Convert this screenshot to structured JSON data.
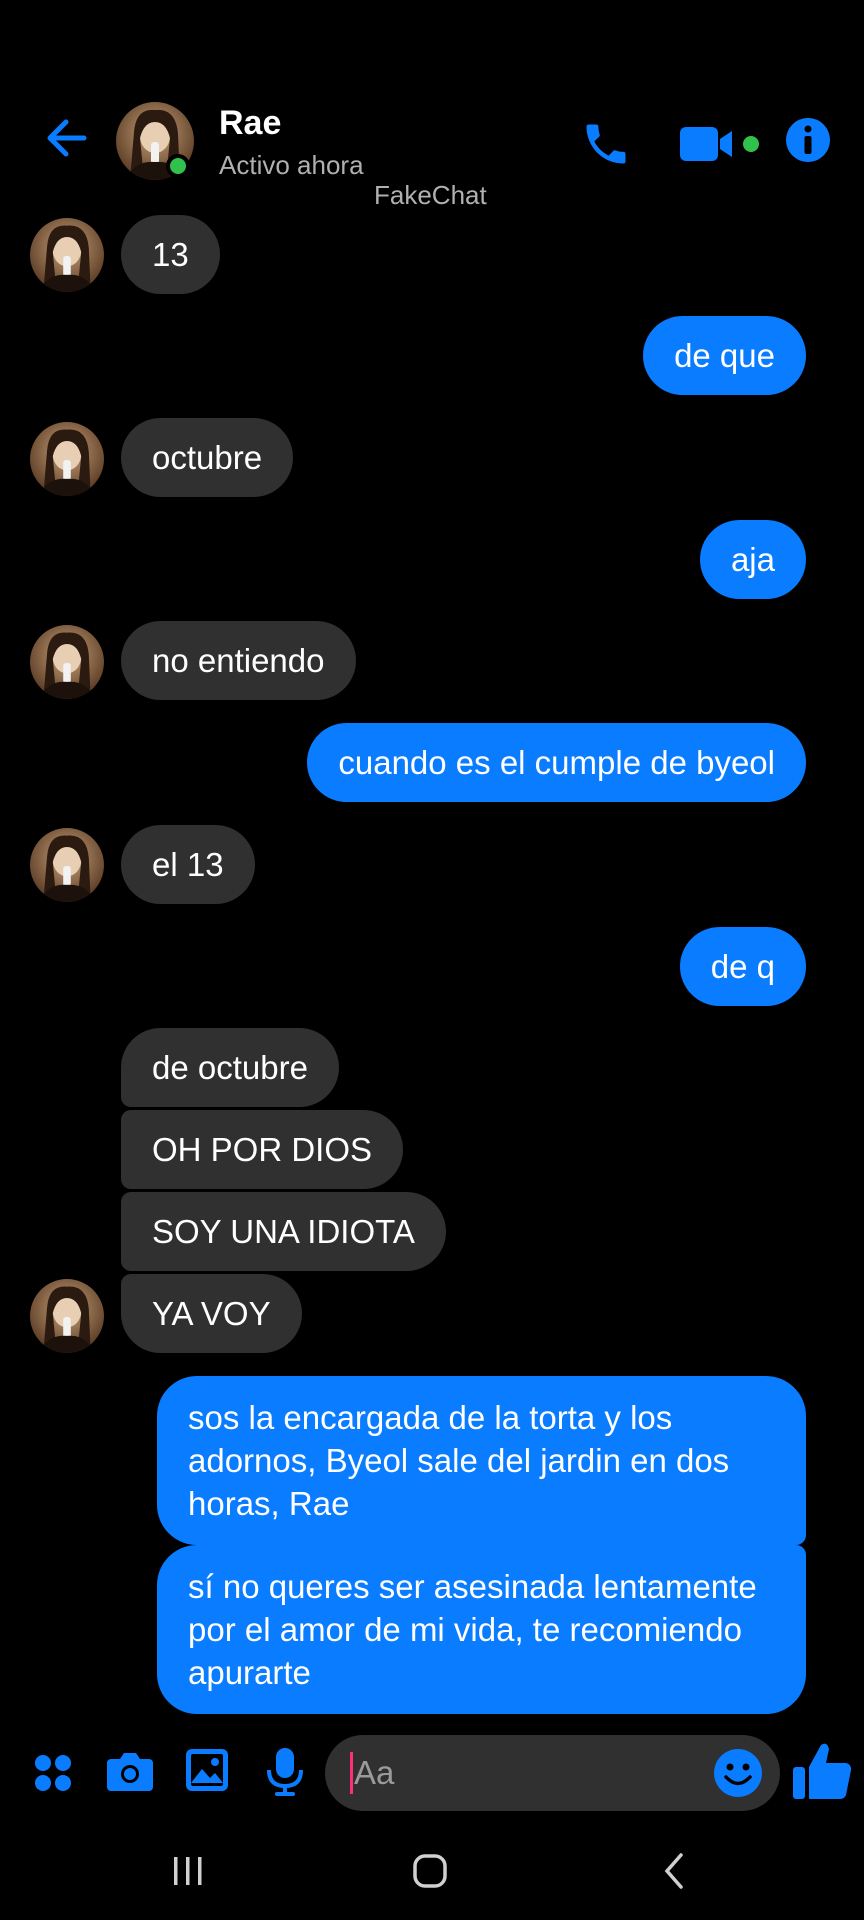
{
  "header": {
    "name": "Rae",
    "status": "Activo ahora",
    "watermark": "FakeChat"
  },
  "colors": {
    "accent": "#0a7cff",
    "background": "#000000",
    "received_bubble": "#303030",
    "online": "#31c24d",
    "caret": "#ff2d7a"
  },
  "icons": {
    "back": "arrow-left-icon",
    "call": "phone-icon",
    "video": "video-camera-icon",
    "info": "info-icon",
    "apps": "apps-grid-icon",
    "camera": "camera-icon",
    "gallery": "image-icon",
    "mic": "microphone-icon",
    "emoji": "smiley-icon",
    "like": "thumbs-up-icon"
  },
  "messages": [
    {
      "from": "Rae",
      "text": "13"
    },
    {
      "from": "me",
      "text": "de que"
    },
    {
      "from": "Rae",
      "text": "octubre"
    },
    {
      "from": "me",
      "text": "aja"
    },
    {
      "from": "Rae",
      "text": "no entiendo"
    },
    {
      "from": "me",
      "text": "cuando es el cumple de byeol"
    },
    {
      "from": "Rae",
      "text": "el 13"
    },
    {
      "from": "me",
      "text": "de q"
    },
    {
      "from": "Rae",
      "text": "de octubre"
    },
    {
      "from": "Rae",
      "text": "OH POR DIOS"
    },
    {
      "from": "Rae",
      "text": "SOY UNA IDIOTA"
    },
    {
      "from": "Rae",
      "text": "YA VOY"
    },
    {
      "from": "me",
      "text": "sos la encargada de la torta y los adornos, Byeol sale del jardin en dos horas, Rae"
    },
    {
      "from": "me",
      "text": "sí no queres ser asesinada lentamente por el amor de mi vida, te recomiendo apurarte"
    }
  ],
  "composer": {
    "placeholder": "Aa"
  }
}
